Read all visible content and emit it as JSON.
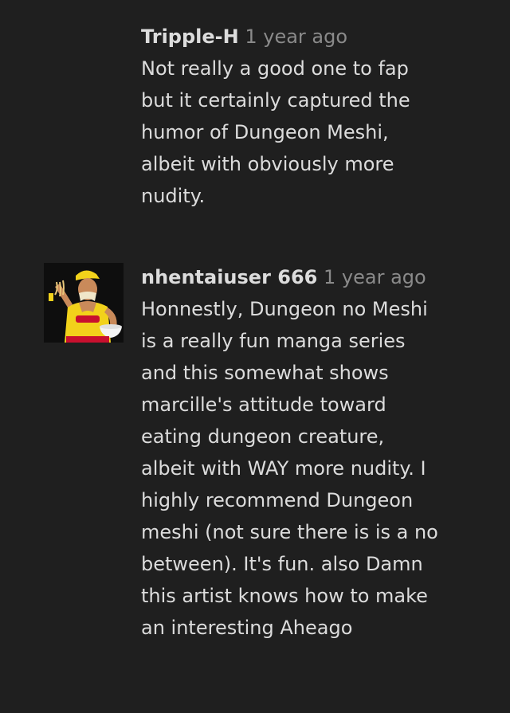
{
  "comments": [
    {
      "username": "Tripple-H",
      "time": "1 year ago",
      "text": "Not really a good one to fap\nbut it certainly captured the\nhumor of Dungeon Meshi,\nalbeit with obviously more\nnudity.",
      "has_avatar": false
    },
    {
      "username": "nhentaiuser 666",
      "time": "1 year ago",
      "text": "Honnestly, Dungeon no Meshi\nis a really fun manga series\nand this somewhat shows\nmarcille's attitude toward\neating dungeon creature,\nalbeit with WAY more nudity. I\nhighly recommend Dungeon\nmeshi (not sure there is is a no\nbetween). It's fun. also Damn\nthis artist knows how to make\nan interesting Aheago",
      "has_avatar": true,
      "avatar_icon": "avatar-muscle-man-eating-noodles"
    }
  ],
  "colors": {
    "background": "#1f1f1f",
    "text": "#dcdcdc",
    "timestamp": "#8a8a8a",
    "avatar_accent_yellow": "#f2d21b",
    "avatar_accent_red": "#c8102e"
  }
}
